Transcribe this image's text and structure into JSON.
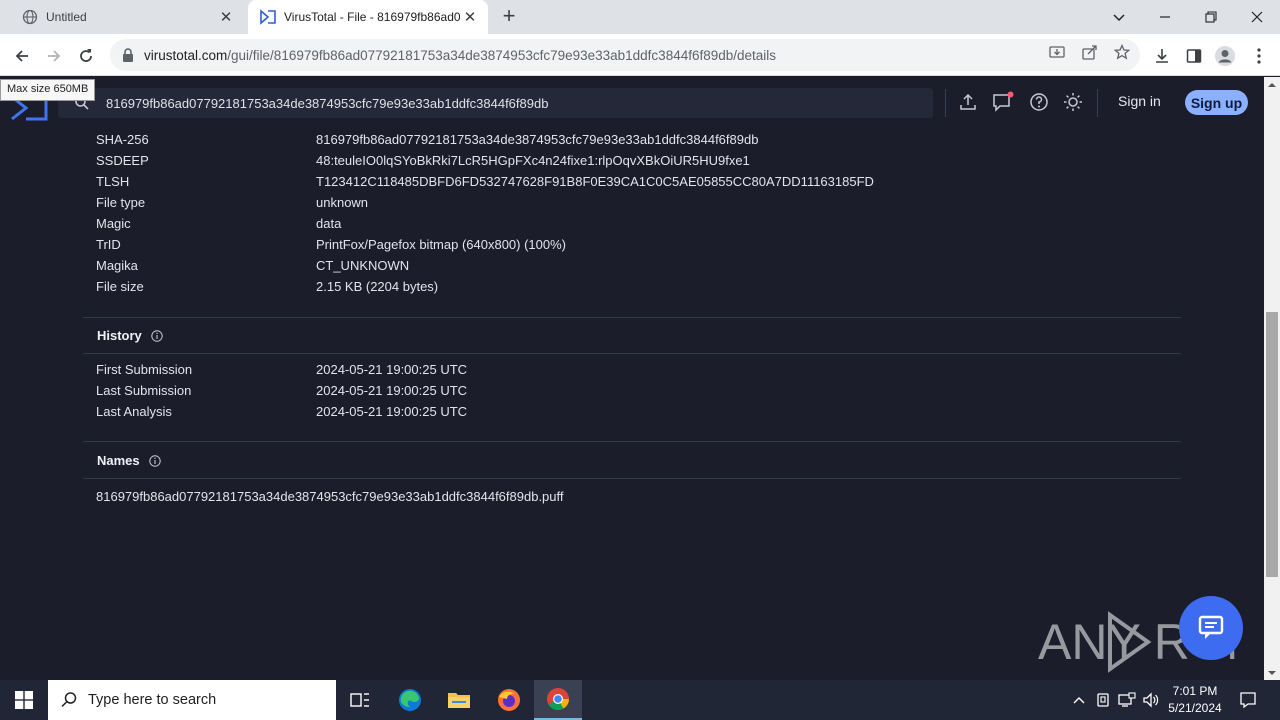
{
  "browser": {
    "tabs": [
      {
        "title": "Untitled",
        "active": false
      },
      {
        "title": "VirusTotal - File - 816979fb86ad0",
        "active": true
      }
    ],
    "url_host": "virustotal.com",
    "url_path": "/gui/file/816979fb86ad07792181753a34de3874953cfc79e93e33ab1ddfc3844f6f89db/details"
  },
  "tooltip": "Max size 650MB",
  "header": {
    "search_value": "816979fb86ad07792181753a34de3874953cfc79e93e33ab1ddfc3844f6f89db",
    "sign_in": "Sign in",
    "sign_up": "Sign up"
  },
  "basic_properties": [
    {
      "key": "SHA-256",
      "value": "816979fb86ad07792181753a34de3874953cfc79e93e33ab1ddfc3844f6f89db"
    },
    {
      "key": "SSDEEP",
      "value": "48:teuleIO0lqSYoBkRki7LcR5HGpFXc4n24fixe1:rlpOqvXBkOiUR5HU9fxe1"
    },
    {
      "key": "TLSH",
      "value": "T123412C118485DBFD6FD532747628F91B8F0E39CA1C0C5AE05855CC80A7DD11163185FD"
    },
    {
      "key": "File type",
      "value": "unknown"
    },
    {
      "key": "Magic",
      "value": "data"
    },
    {
      "key": "TrID",
      "value": "PrintFox/Pagefox bitmap (640x800) (100%)"
    },
    {
      "key": "Magika",
      "value": "CT_UNKNOWN"
    },
    {
      "key": "File size",
      "value": "2.15 KB (2204 bytes)"
    }
  ],
  "history": {
    "title": "History",
    "rows": [
      {
        "key": "First Submission",
        "value": "2024-05-21 19:00:25 UTC"
      },
      {
        "key": "Last Submission",
        "value": "2024-05-21 19:00:25 UTC"
      },
      {
        "key": "Last Analysis",
        "value": "2024-05-21 19:00:25 UTC"
      }
    ]
  },
  "names": {
    "title": "Names",
    "items": [
      "816979fb86ad07792181753a34de3874953cfc79e93e33ab1ddfc3844f6f89db.puff"
    ]
  },
  "watermark": "ANY RUN",
  "taskbar": {
    "search_placeholder": "Type here to search",
    "time": "7:01 PM",
    "date": "5/21/2024"
  }
}
